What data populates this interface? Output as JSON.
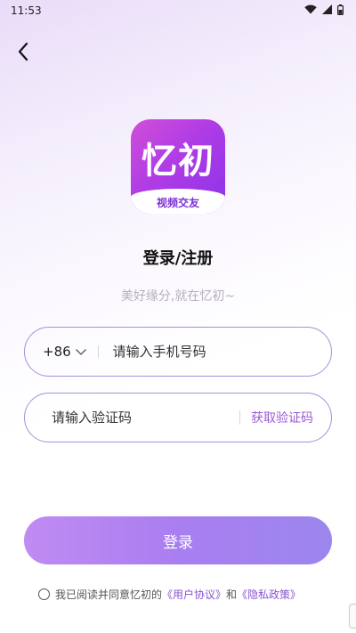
{
  "status_bar": {
    "time": "11:53",
    "icons": [
      "wifi-icon",
      "signal-icon",
      "battery-icon"
    ]
  },
  "header": {
    "back_icon": "chevron-left-icon"
  },
  "logo": {
    "main_text": "忆初",
    "sub_text": "视频交友",
    "colors": [
      "#d04fd8",
      "#8b33e8"
    ]
  },
  "title": "登录/注册",
  "slogan": "美好缘分,就在忆初~",
  "phone_field": {
    "country_code": "+86",
    "dropdown_icon": "chevron-down-icon",
    "placeholder": "请输入手机号码",
    "value": ""
  },
  "code_field": {
    "placeholder": "请输入验证码",
    "value": "",
    "get_code_label": "获取验证码"
  },
  "login_button": {
    "label": "登录"
  },
  "agreement": {
    "prefix": "我已阅读并同意忆初的",
    "user_agreement": "《用户协议》",
    "and": "和",
    "privacy_policy": "《隐私政策》",
    "checked": false
  },
  "colors": {
    "accent": "#9a5bd6",
    "border": "#a98fd9",
    "button_start": "#c08bf2",
    "button_end": "#9c86ee"
  }
}
